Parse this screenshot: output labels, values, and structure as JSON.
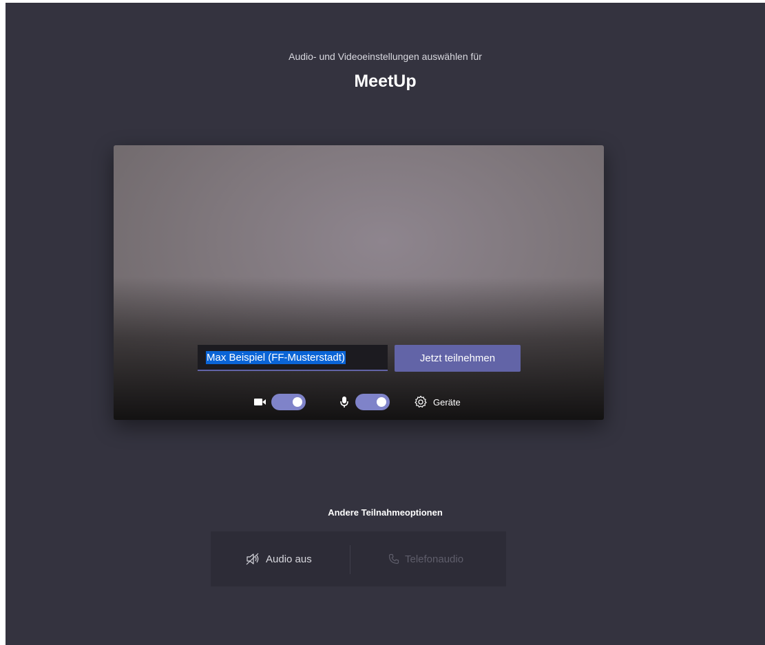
{
  "header": {
    "subtitle": "Audio- und Videoeinstellungen auswählen für",
    "meeting_title": "MeetUp"
  },
  "preview": {
    "name_input_value": "Max Beispiel (FF-Musterstadt)",
    "join_label": "Jetzt teilnehmen",
    "camera_icon": "camera-icon",
    "camera_on": true,
    "mic_icon": "microphone-icon",
    "mic_on": true,
    "devices_icon": "gear-icon",
    "devices_label": "Geräte"
  },
  "other_options": {
    "title": "Andere Teilnahmeoptionen",
    "audio_off_icon": "speaker-muted-icon",
    "audio_off_label": "Audio aus",
    "phone_icon": "phone-icon",
    "phone_label": "Telefonaudio"
  },
  "colors": {
    "background": "#34333f",
    "accent": "#6264a7",
    "toggle_on": "#7f83c9",
    "selection": "#0a64d6"
  }
}
